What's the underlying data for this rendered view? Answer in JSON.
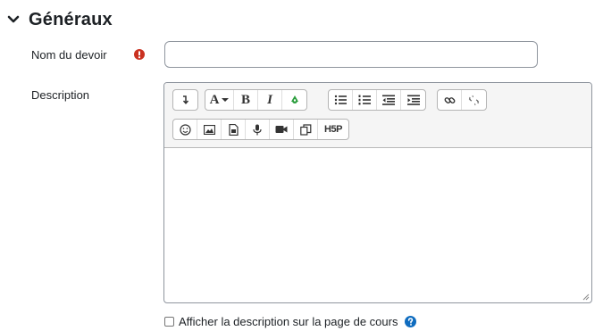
{
  "section": {
    "title": "Généraux"
  },
  "fields": {
    "name_label": "Nom du devoir",
    "description_label": "Description",
    "name_value": ""
  },
  "toolbar": {
    "font_button": "A",
    "bold": "B",
    "italic": "I",
    "h5p": "H5P"
  },
  "checkbox": {
    "label": "Afficher la description sur la page de cours",
    "checked": false
  },
  "colors": {
    "required": "#ca3120",
    "help": "#0f6cbf",
    "accessibility": "#2a9d3c"
  }
}
